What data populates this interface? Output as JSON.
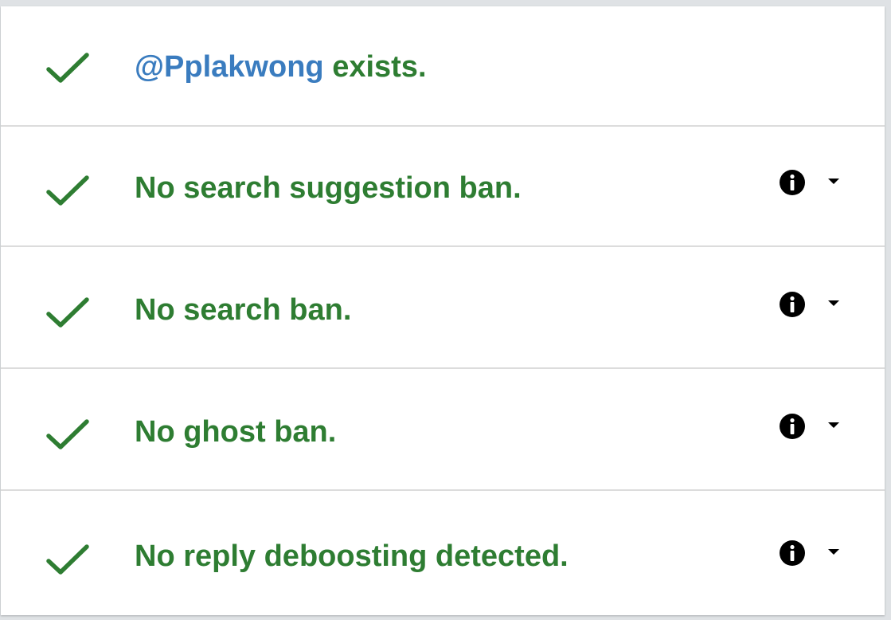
{
  "results": {
    "exists": {
      "handle": "@Pplakwong",
      "text": " exists."
    },
    "checks": [
      {
        "label": "No search suggestion ban."
      },
      {
        "label": "No search ban."
      },
      {
        "label": "No ghost ban."
      },
      {
        "label": "No reply deboosting detected."
      }
    ]
  },
  "colors": {
    "pass_green": "#2e7d32",
    "handle_blue": "#3a7cbf",
    "divider": "#dcdcdc"
  },
  "icons": {
    "status": "check-icon",
    "info": "info-icon",
    "expand": "caret-down-icon"
  }
}
